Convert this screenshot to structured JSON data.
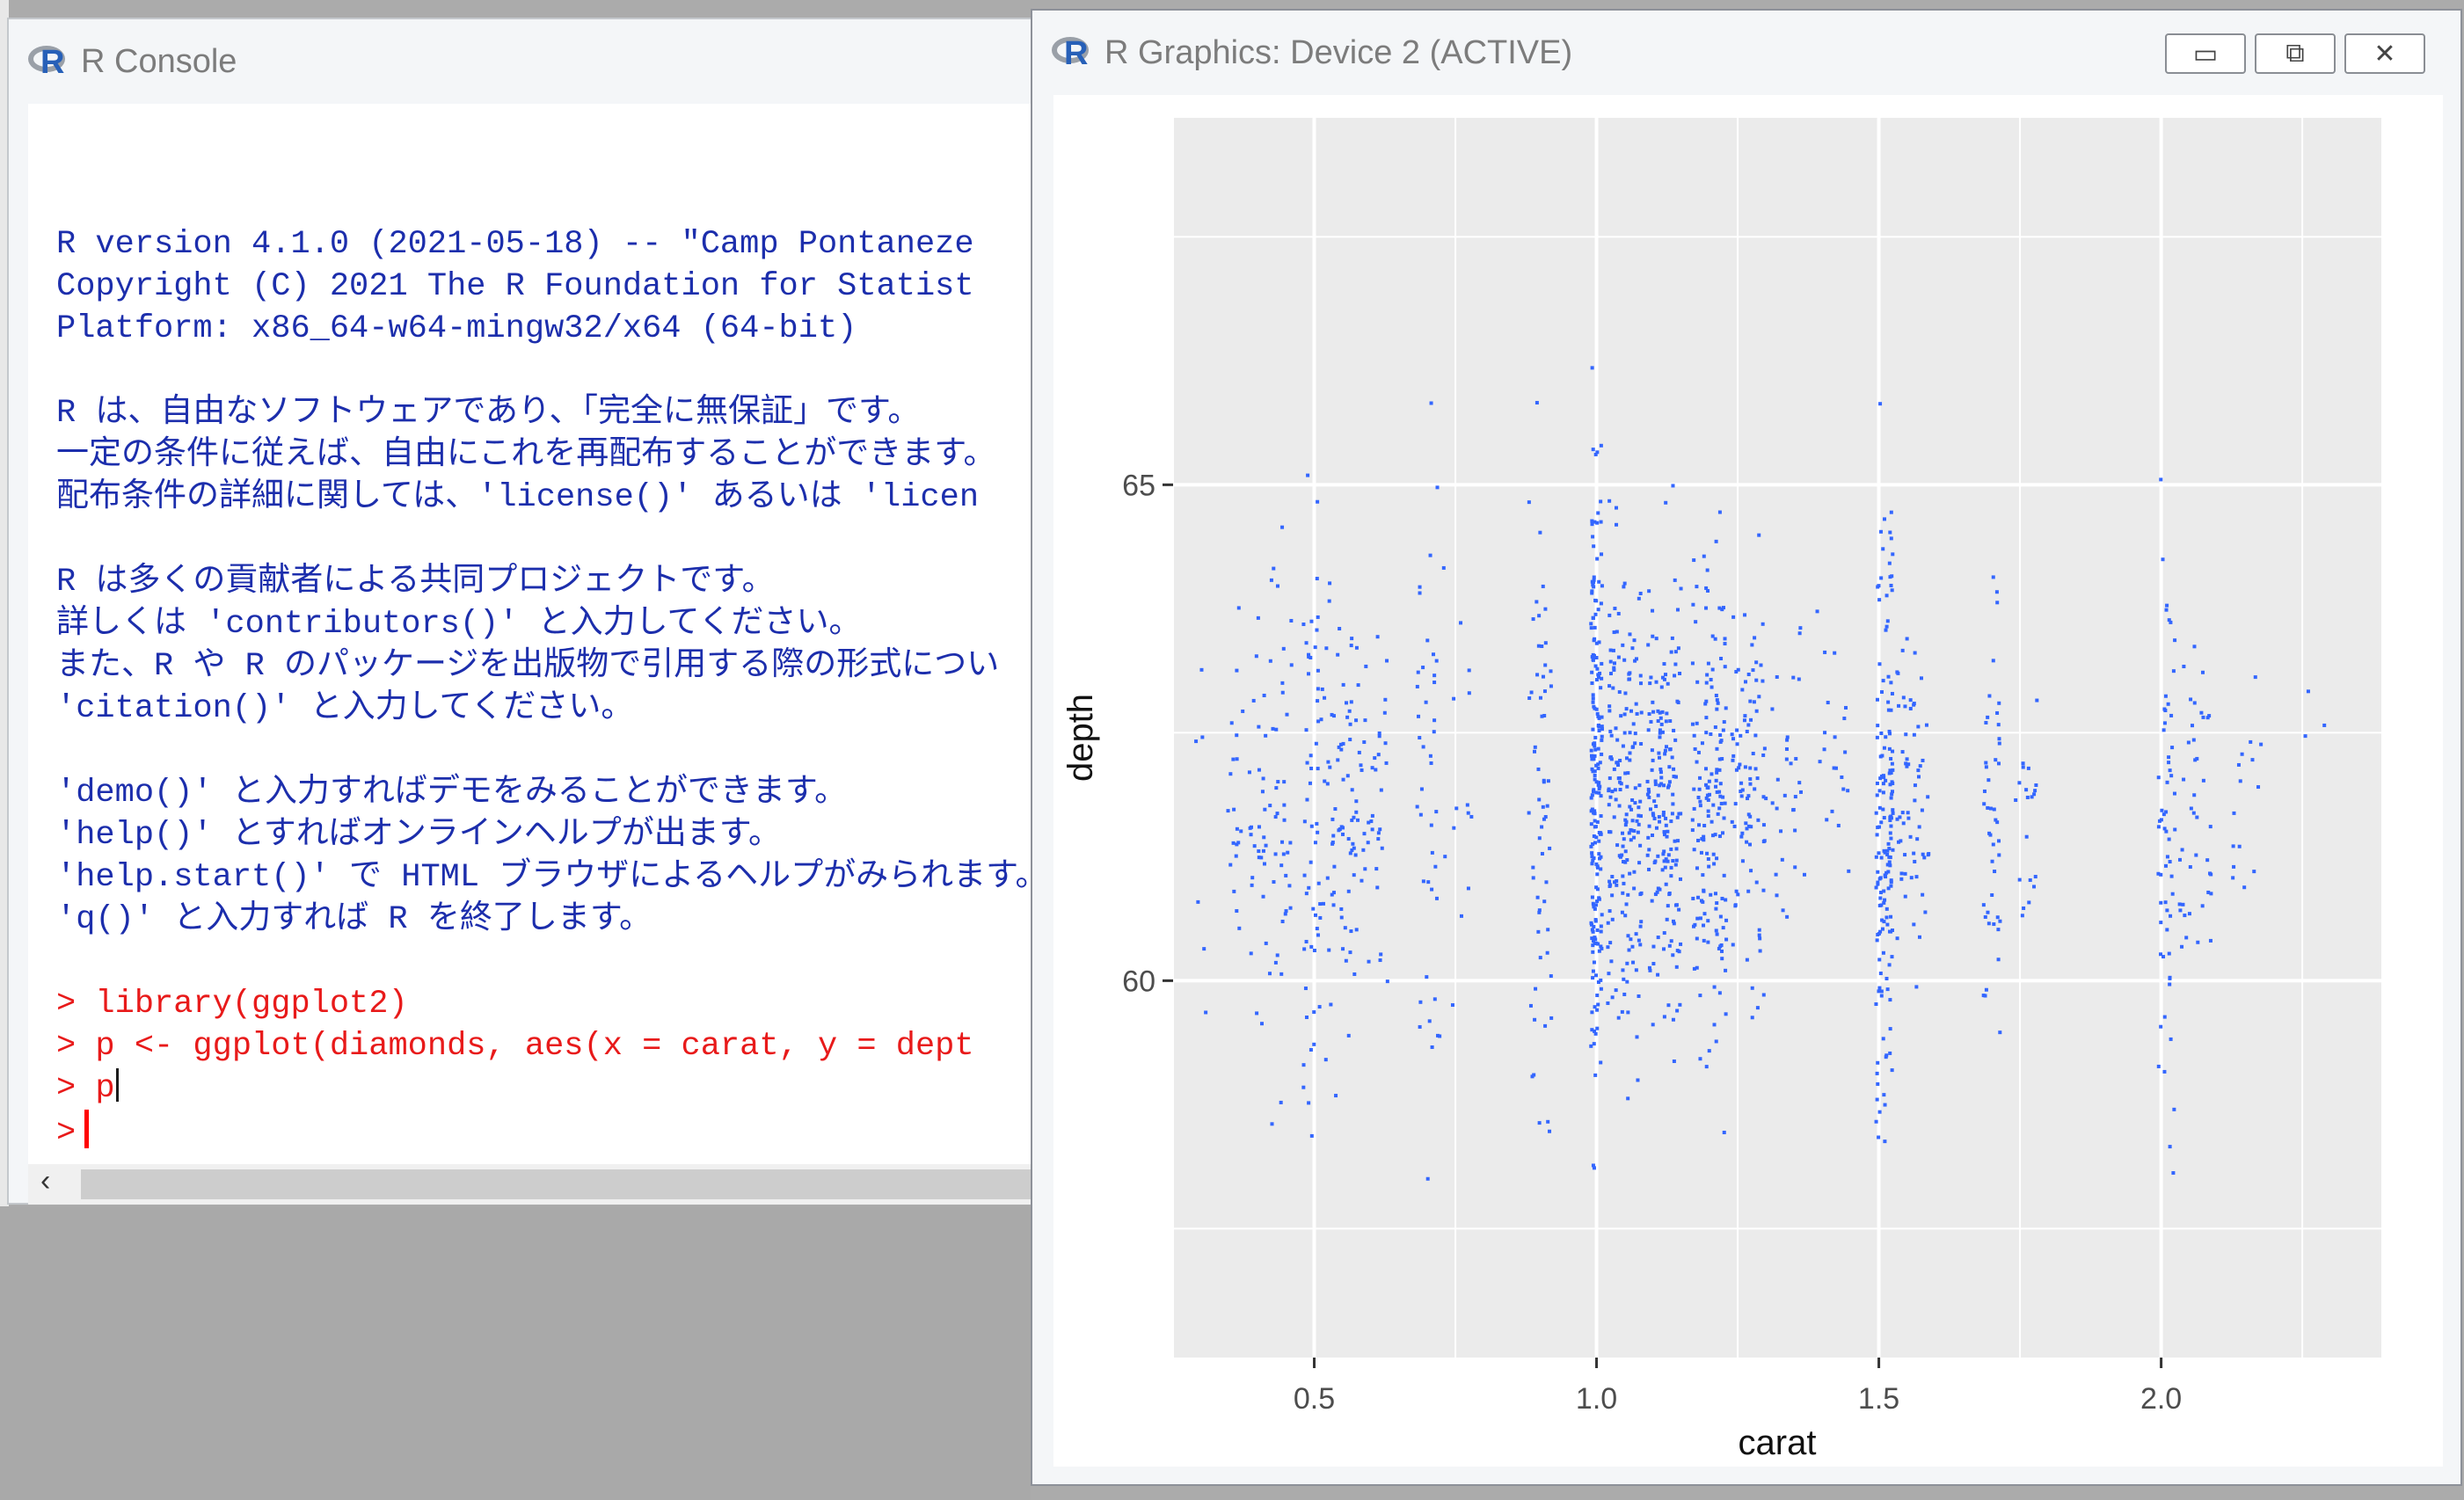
{
  "console": {
    "title": "R Console",
    "lines": [
      {
        "t": "",
        "c": "blue"
      },
      {
        "t": "R version 4.1.0 (2021-05-18) -- \"Camp Pontaneze",
        "c": "blue"
      },
      {
        "t": "Copyright (C) 2021 The R Foundation for Statist",
        "c": "blue"
      },
      {
        "t": "Platform: x86_64-w64-mingw32/x64 (64-bit)",
        "c": "blue"
      },
      {
        "t": "",
        "c": "blue"
      },
      {
        "t": "R は、自由なソフトウェアであり、「完全に無保証」です。",
        "c": "blue"
      },
      {
        "t": "一定の条件に従えば、自由にこれを再配布することができます。",
        "c": "blue"
      },
      {
        "t": "配布条件の詳細に関しては、'license()' あるいは 'licen",
        "c": "blue"
      },
      {
        "t": "",
        "c": "blue"
      },
      {
        "t": "R は多くの貢献者による共同プロジェクトです。",
        "c": "blue"
      },
      {
        "t": "詳しくは 'contributors()' と入力してください。",
        "c": "blue"
      },
      {
        "t": "また、R や R のパッケージを出版物で引用する際の形式につい",
        "c": "blue"
      },
      {
        "t": "'citation()' と入力してください。",
        "c": "blue"
      },
      {
        "t": "",
        "c": "blue"
      },
      {
        "t": "'demo()' と入力すればデモをみることができます。",
        "c": "blue"
      },
      {
        "t": "'help()' とすればオンラインヘルプが出ます。",
        "c": "blue"
      },
      {
        "t": "'help.start()' で HTML ブラウザによるヘルプがみられます。",
        "c": "blue"
      },
      {
        "t": "'q()' と入力すれば R を終了します。",
        "c": "blue"
      },
      {
        "t": "",
        "c": "blue"
      },
      {
        "t": "> library(ggplot2)",
        "c": "red"
      },
      {
        "t": "> p <- ggplot(diamonds, aes(x = carat, y = dept",
        "c": "red"
      },
      {
        "t": "> p",
        "c": "red",
        "caret": "thin"
      },
      {
        "t": ">",
        "c": "red",
        "caret": "big"
      }
    ],
    "scroll_left_glyph": "‹"
  },
  "graphics": {
    "title": "R Graphics: Device 2 (ACTIVE)",
    "buttons": {
      "minimize": "▭",
      "restore": "⧉",
      "close": "✕"
    },
    "chart_data": {
      "type": "scatter",
      "xlabel": "carat",
      "ylabel": "depth",
      "x_ticks": [
        "0.5",
        "1.0",
        "1.5",
        "2.0"
      ],
      "y_ticks": [
        "60",
        "65"
      ],
      "xlim": [
        0.25,
        2.39
      ],
      "ylim": [
        56.2,
        68.7
      ],
      "point_color": "#3366ff",
      "panel_background": "#ebebeb",
      "clusters": [
        {
          "x": 0.3,
          "w": 0.01,
          "y": 61.5,
          "sd": 1.1,
          "n": 6
        },
        {
          "x": 0.36,
          "w": 0.015,
          "y": 61.8,
          "sd": 0.9,
          "n": 20
        },
        {
          "x": 0.4,
          "w": 0.015,
          "y": 61.8,
          "sd": 1.0,
          "n": 30
        },
        {
          "x": 0.44,
          "w": 0.02,
          "y": 61.8,
          "sd": 1.2,
          "n": 40
        },
        {
          "x": 0.5,
          "w": 0.02,
          "y": 61.8,
          "sd": 1.3,
          "n": 60
        },
        {
          "x": 0.55,
          "w": 0.03,
          "y": 61.8,
          "sd": 1.2,
          "n": 70
        },
        {
          "x": 0.6,
          "w": 0.03,
          "y": 61.7,
          "sd": 1.1,
          "n": 40
        },
        {
          "x": 0.7,
          "w": 0.02,
          "y": 61.8,
          "sd": 1.6,
          "n": 40
        },
        {
          "x": 0.75,
          "w": 0.03,
          "y": 61.9,
          "sd": 1.0,
          "n": 15
        },
        {
          "x": 0.9,
          "w": 0.02,
          "y": 61.8,
          "sd": 1.5,
          "n": 60
        },
        {
          "x": 1.0,
          "w": 0.01,
          "y": 62.0,
          "sd": 1.6,
          "n": 200
        },
        {
          "x": 1.05,
          "w": 0.03,
          "y": 61.9,
          "sd": 1.2,
          "n": 180
        },
        {
          "x": 1.12,
          "w": 0.03,
          "y": 61.8,
          "sd": 1.1,
          "n": 170
        },
        {
          "x": 1.2,
          "w": 0.03,
          "y": 61.8,
          "sd": 1.1,
          "n": 160
        },
        {
          "x": 1.27,
          "w": 0.03,
          "y": 61.9,
          "sd": 0.9,
          "n": 90
        },
        {
          "x": 1.34,
          "w": 0.03,
          "y": 62.0,
          "sd": 0.7,
          "n": 30
        },
        {
          "x": 1.42,
          "w": 0.03,
          "y": 62.2,
          "sd": 0.6,
          "n": 20
        },
        {
          "x": 1.51,
          "w": 0.015,
          "y": 61.8,
          "sd": 1.5,
          "n": 160
        },
        {
          "x": 1.56,
          "w": 0.03,
          "y": 61.9,
          "sd": 0.9,
          "n": 60
        },
        {
          "x": 1.7,
          "w": 0.015,
          "y": 61.7,
          "sd": 1.2,
          "n": 45
        },
        {
          "x": 1.76,
          "w": 0.02,
          "y": 61.7,
          "sd": 0.7,
          "n": 20
        },
        {
          "x": 2.01,
          "w": 0.015,
          "y": 61.5,
          "sd": 1.4,
          "n": 60
        },
        {
          "x": 2.06,
          "w": 0.03,
          "y": 61.7,
          "sd": 0.9,
          "n": 40
        },
        {
          "x": 2.15,
          "w": 0.03,
          "y": 61.8,
          "sd": 0.6,
          "n": 15
        },
        {
          "x": 2.27,
          "w": 0.02,
          "y": 62.3,
          "sd": 0.3,
          "n": 3
        }
      ]
    }
  }
}
